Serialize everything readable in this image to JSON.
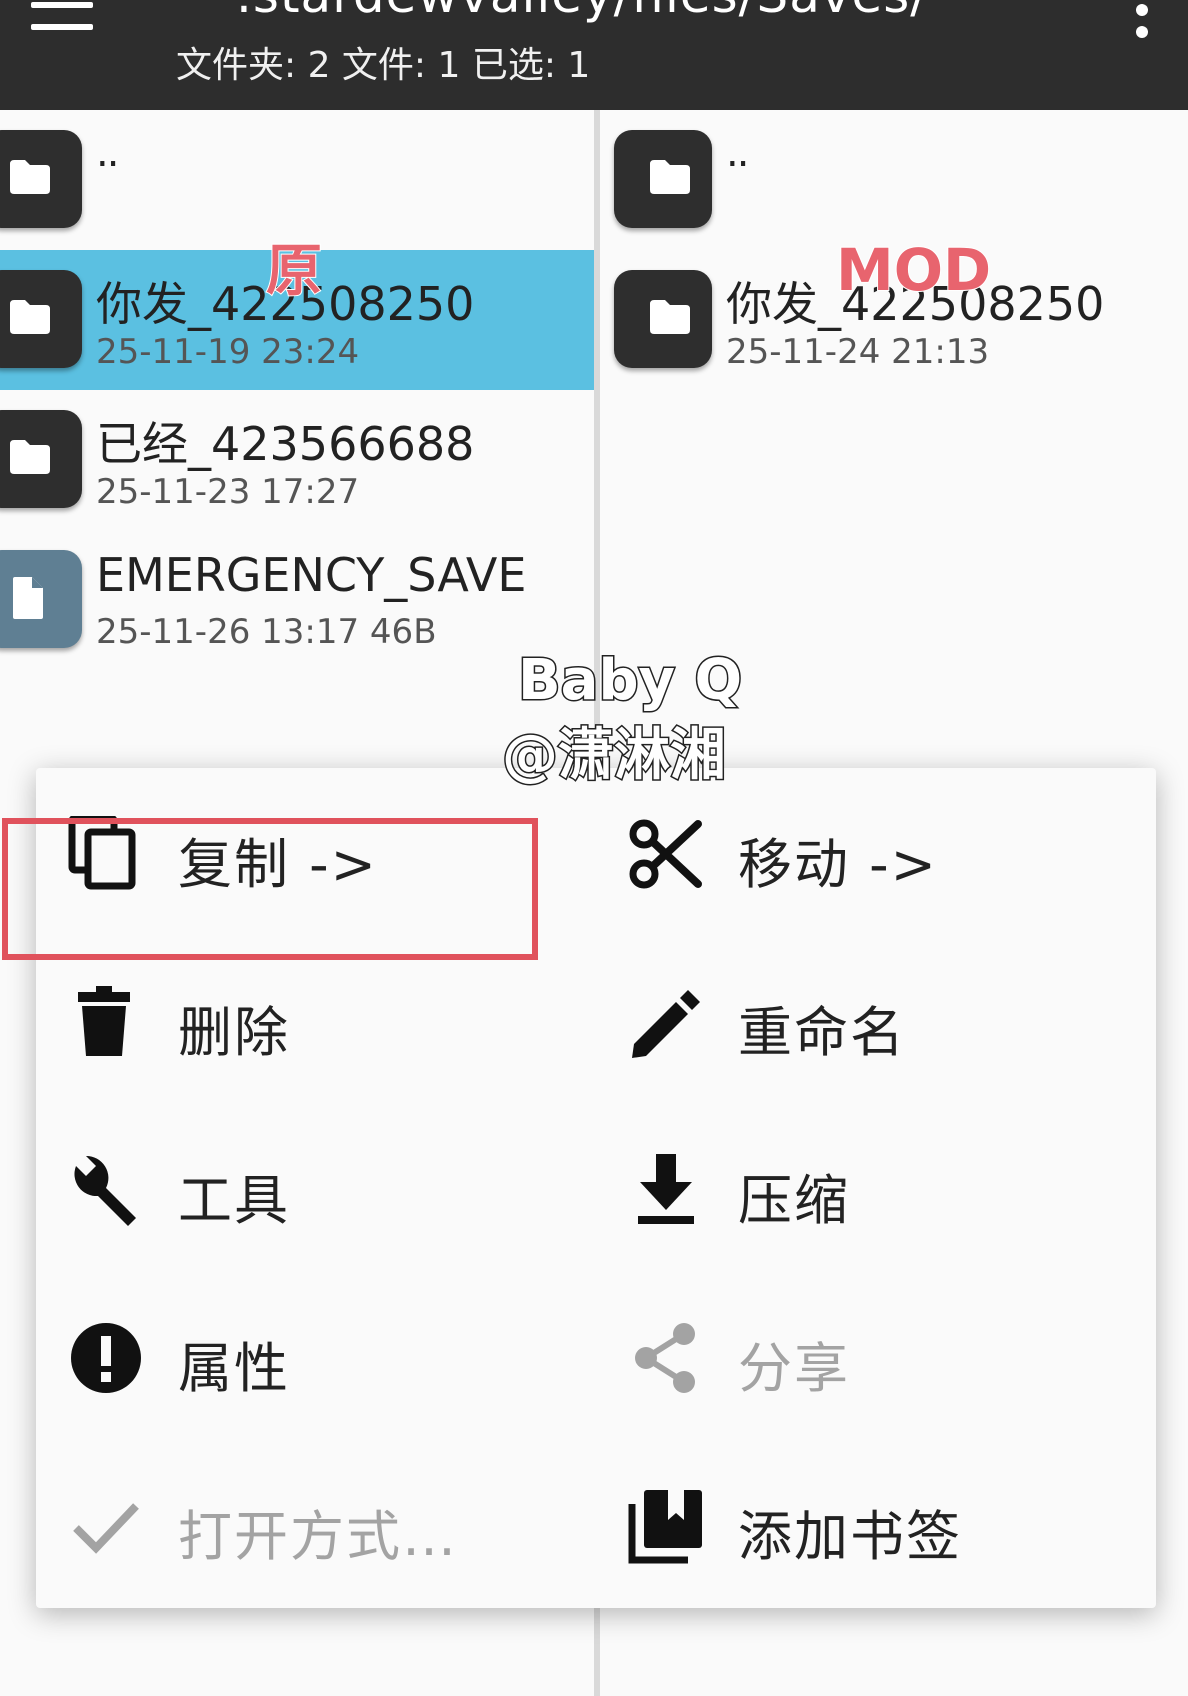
{
  "header": {
    "path_title": ".stardewvalley/files/Saves/",
    "stats": "文件夹: 2   文件: 1   已选: 1",
    "menu_icon": "hamburger-menu-icon",
    "overflow_icon": "more-vert-icon"
  },
  "left_pane": {
    "parent": "..",
    "items": [
      {
        "name": "你发_422508250",
        "meta": "25-11-19 23:24",
        "type": "folder",
        "selected": true
      },
      {
        "name": "已经_423566688",
        "meta": "25-11-23 17:27",
        "type": "folder",
        "selected": false
      },
      {
        "name": "EMERGENCY_SAVE",
        "meta": "25-11-26 13:17  46B",
        "type": "file",
        "selected": false
      }
    ]
  },
  "right_pane": {
    "parent": "..",
    "items": [
      {
        "name": "你发_422508250",
        "meta": "25-11-24 21:13",
        "type": "folder"
      }
    ]
  },
  "overlays": {
    "label_original": "原",
    "label_mod": "MOD",
    "watermark_line1": "Baby Q",
    "watermark_line2": "@潇淋湘"
  },
  "actions": {
    "copy": "复制 ->",
    "move": "移动 ->",
    "delete": "删除",
    "rename": "重命名",
    "tools": "工具",
    "compress": "压缩",
    "properties": "属性",
    "share": "分享",
    "open_with": "打开方式…",
    "add_bookmark": "添加书签"
  },
  "colors": {
    "header_bg": "#2d2d2d",
    "selection": "#5bc0e1",
    "highlight_box": "#e0525c",
    "disabled_text": "#a3a3a3"
  }
}
